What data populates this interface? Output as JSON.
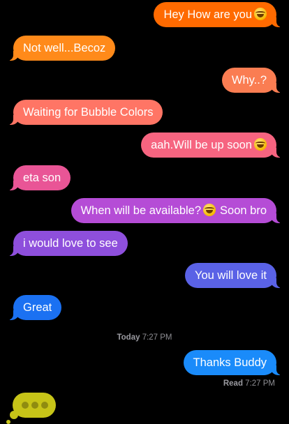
{
  "messages": [
    {
      "text": "Hey How are you",
      "emoji": "tears-of-joy-emoji",
      "direction": "out",
      "color": "#ff6a00"
    },
    {
      "text": "Not well...Becoz",
      "direction": "in",
      "color": "#ff8a1a"
    },
    {
      "text": "Why..?",
      "direction": "out",
      "color": "#fa7d52"
    },
    {
      "text": "Waiting for Bubble Colors",
      "direction": "in",
      "color": "#ff7565"
    },
    {
      "text": "aah.Will be up soon",
      "emoji": "tears-of-joy-emoji",
      "direction": "out",
      "color": "#f66480"
    },
    {
      "text": "eta son",
      "direction": "in",
      "color": "#e95596"
    },
    {
      "text": "When will be available?",
      "emoji": "tears-of-joy-emoji",
      "text_after": "Soon bro",
      "direction": "out",
      "color": "#b54cd6"
    },
    {
      "text": "i would love to see",
      "direction": "in",
      "color": "#8e4fdc"
    },
    {
      "text": "You will love it",
      "direction": "out",
      "color": "#5a62e6"
    },
    {
      "text": "Great",
      "direction": "in",
      "color": "#1b71f2"
    },
    {
      "text": "Thanks Buddy",
      "direction": "out",
      "color": "#1a8bfa"
    }
  ],
  "timestamp": {
    "day": "Today",
    "time": "7:27 PM"
  },
  "read_receipt": {
    "label": "Read",
    "time": "7:27 PM"
  },
  "typing_indicator": {
    "color": "#c7c418",
    "dot_color": "#8f8c10"
  }
}
